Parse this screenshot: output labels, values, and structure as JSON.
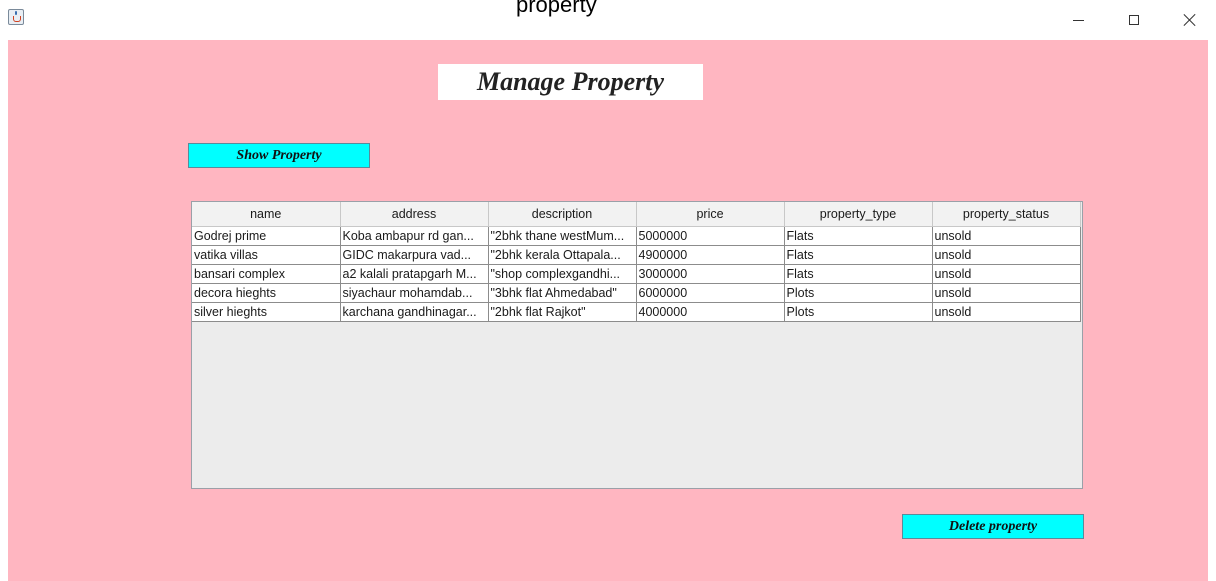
{
  "window": {
    "title": "property",
    "app_icon": "java-cup-icon",
    "controls": [
      "minimize-icon",
      "maximize-icon",
      "close-icon"
    ]
  },
  "colors": {
    "panel_background": "#ffb6c1",
    "button_background": "#00ffff",
    "heading_background": "#ffffff"
  },
  "header": {
    "title": "Manage Property"
  },
  "buttons": {
    "show_label": "Show Property",
    "delete_label": "Delete property"
  },
  "table": {
    "columns": [
      "name",
      "address",
      "description",
      "price",
      "property_type",
      "property_status"
    ],
    "rows": [
      [
        "Godrej prime",
        "Koba ambapur rd gan...",
        "\"2bhk thane westMum...",
        "5000000",
        "Flats",
        "unsold"
      ],
      [
        "vatika villas",
        "GIDC makarpura vad...",
        "\"2bhk kerala Ottapala...",
        "4900000",
        "Flats",
        "unsold"
      ],
      [
        "bansari complex",
        "a2 kalali pratapgarh M...",
        "\"shop complexgandhi...",
        "3000000",
        "Flats",
        "unsold"
      ],
      [
        "decora hieghts",
        "siyachaur mohamdab...",
        "\"3bhk flat Ahmedabad\"",
        "6000000",
        "Plots",
        "unsold"
      ],
      [
        "silver hieghts",
        "karchana gandhinagar...",
        "\"2bhk flat Rajkot\"",
        "4000000",
        "Plots",
        "unsold"
      ]
    ]
  }
}
